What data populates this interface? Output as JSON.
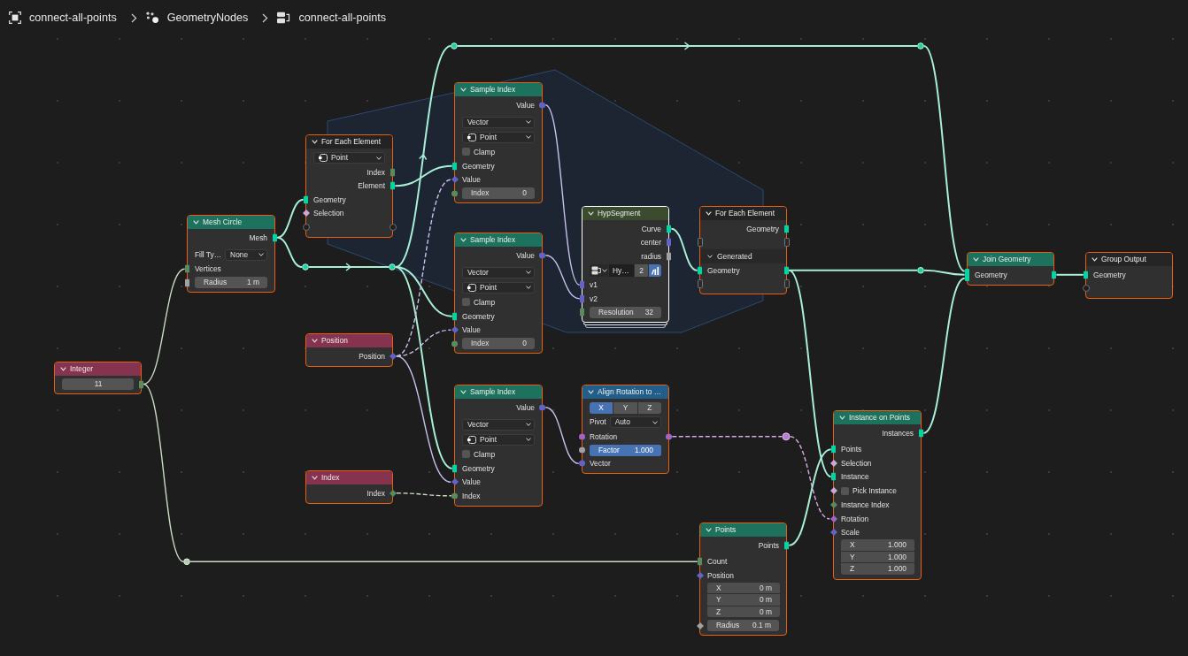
{
  "breadcrumbs": [
    {
      "kind": "object",
      "label": "connect-all-points"
    },
    {
      "kind": "modifier",
      "label": "GeometryNodes"
    },
    {
      "kind": "node_group",
      "label": "connect-all-points"
    }
  ],
  "nodes": [
    {
      "title": "Integer",
      "kind": "input",
      "selected": true,
      "active": false,
      "rows": [
        {
          "kind": "field",
          "value": "11",
          "output": {
            "kind": "bar",
            "color": "#598c5c"
          }
        }
      ]
    },
    {
      "title": "Mesh Circle",
      "kind": "geometry",
      "selected": true,
      "active": false,
      "rows": [
        {
          "kind": "socket",
          "label": "Mesh",
          "output": {
            "kind": "bar",
            "color": "#00d6a3"
          }
        },
        {
          "kind": "dropdown",
          "label": "Fill Ty…",
          "value": "None"
        },
        {
          "kind": "socket",
          "label": "Vertices",
          "input": {
            "kind": "bar",
            "color": "#598c5c"
          }
        },
        {
          "kind": "field",
          "label": "Radius",
          "value": "1 m",
          "input": {
            "kind": "bar",
            "color": "#a1a1a1"
          }
        }
      ]
    },
    {
      "title": "For Each Element",
      "kind": "zone",
      "selected": true,
      "active": false,
      "rows": [
        {
          "kind": "domain",
          "value": "Point"
        },
        {
          "kind": "socket",
          "label": "Index",
          "output": {
            "kind": "bar",
            "color": "#598c5c"
          }
        },
        {
          "kind": "socket",
          "label": "Element",
          "output": {
            "kind": "bar",
            "color": "#00d6a3"
          }
        },
        {
          "kind": "socket",
          "label": "Geometry",
          "input": {
            "kind": "bar",
            "color": "#00d6a3"
          }
        },
        {
          "kind": "socket",
          "label": "Selection",
          "input": {
            "kind": "diamond",
            "color": "#cca6d6"
          }
        },
        {
          "kind": "socket",
          "input": {
            "kind": "ring"
          },
          "output": {
            "kind": "ring"
          }
        }
      ]
    },
    {
      "title": "Position",
      "kind": "input",
      "selected": true,
      "active": false,
      "rows": [
        {
          "kind": "socket",
          "label": "Position",
          "output": {
            "kind": "diamond",
            "color": "#6363c7"
          }
        }
      ]
    },
    {
      "title": "Index",
      "kind": "input",
      "selected": true,
      "active": false,
      "rows": [
        {
          "kind": "socket",
          "label": "Index",
          "output": {
            "kind": "diamond",
            "color": "#598c5c"
          }
        }
      ]
    },
    {
      "title": "Sample Index",
      "kind": "geometry",
      "selected": true,
      "active": false,
      "rows": [
        {
          "kind": "socket",
          "label": "Value",
          "output": {
            "kind": "circle",
            "color": "#6363c7"
          }
        },
        {
          "kind": "dropdown",
          "value": "Vector"
        },
        {
          "kind": "domain",
          "value": "Point"
        },
        {
          "kind": "checkbox",
          "label": "Clamp",
          "checked": false
        },
        {
          "kind": "socket",
          "label": "Geometry",
          "input": {
            "kind": "bar",
            "color": "#00d6a3"
          }
        },
        {
          "kind": "socket",
          "label": "Value",
          "input": {
            "kind": "diamond",
            "color": "#6363c7"
          }
        },
        {
          "kind": "field",
          "label": "Index",
          "value": "0",
          "input": {
            "kind": "circle",
            "color": "#598c5c"
          }
        }
      ]
    },
    {
      "title": "Sample Index",
      "kind": "geometry",
      "selected": true,
      "active": false,
      "rows": [
        {
          "kind": "socket",
          "label": "Value",
          "output": {
            "kind": "circle",
            "color": "#6363c7"
          }
        },
        {
          "kind": "dropdown",
          "value": "Vector"
        },
        {
          "kind": "domain",
          "value": "Point"
        },
        {
          "kind": "checkbox",
          "label": "Clamp",
          "checked": false
        },
        {
          "kind": "socket",
          "label": "Geometry",
          "input": {
            "kind": "bar",
            "color": "#00d6a3"
          }
        },
        {
          "kind": "socket",
          "label": "Value",
          "input": {
            "kind": "diamond",
            "color": "#6363c7"
          }
        },
        {
          "kind": "field",
          "label": "Index",
          "value": "0",
          "input": {
            "kind": "circle",
            "color": "#598c5c"
          }
        }
      ]
    },
    {
      "title": "Sample Index",
      "kind": "geometry",
      "selected": true,
      "active": false,
      "rows": [
        {
          "kind": "socket",
          "label": "Value",
          "output": {
            "kind": "circle",
            "color": "#6363c7"
          }
        },
        {
          "kind": "dropdown",
          "value": "Vector"
        },
        {
          "kind": "domain",
          "value": "Point"
        },
        {
          "kind": "checkbox",
          "label": "Clamp",
          "checked": false
        },
        {
          "kind": "socket",
          "label": "Geometry",
          "input": {
            "kind": "bar",
            "color": "#00d6a3"
          }
        },
        {
          "kind": "socket",
          "label": "Value",
          "input": {
            "kind": "diamond",
            "color": "#6363c7"
          }
        },
        {
          "kind": "socket",
          "label": "Index",
          "input": {
            "kind": "circle",
            "color": "#598c5c"
          }
        }
      ]
    },
    {
      "title": "HypSegment",
      "kind": "group",
      "selected": true,
      "active": true,
      "rows": [
        {
          "kind": "socket",
          "label": "Curve",
          "output": {
            "kind": "bar",
            "color": "#00d6a3"
          }
        },
        {
          "kind": "socket",
          "label": "center",
          "output": {
            "kind": "bar",
            "color": "#6363c7"
          }
        },
        {
          "kind": "socket",
          "label": "radius",
          "output": {
            "kind": "bar",
            "color": "#a1a1a1"
          }
        },
        {
          "kind": "datablock",
          "name": "Hy…",
          "users": "2",
          "on": true
        },
        {
          "kind": "socket",
          "label": "v1",
          "input": {
            "kind": "bar",
            "color": "#6363c7"
          }
        },
        {
          "kind": "socket",
          "label": "v2",
          "input": {
            "kind": "bar",
            "color": "#6363c7"
          }
        },
        {
          "kind": "field",
          "label": "Resolution",
          "value": "32",
          "input": {
            "kind": "bar",
            "color": "#598c5c"
          }
        }
      ]
    },
    {
      "title": "Align Rotation to …",
      "kind": "converter",
      "selected": true,
      "active": false,
      "rows": [
        {
          "kind": "toggle",
          "options": [
            {
              "label": "X",
              "selected": true
            },
            {
              "label": "Y",
              "selected": false
            },
            {
              "label": "Z",
              "selected": false
            }
          ]
        },
        {
          "kind": "dropdown",
          "label": "Pivot",
          "value": "Auto"
        },
        {
          "kind": "socket",
          "label": "Rotation",
          "input": {
            "kind": "circle",
            "color": "#a663c7"
          },
          "output": {
            "kind": "circle",
            "color": "#a663c7"
          }
        },
        {
          "kind": "slider",
          "label": "Factor",
          "value": "1.000",
          "level": 1,
          "input": {
            "kind": "circle",
            "color": "#a1a1a1"
          }
        },
        {
          "kind": "socket",
          "label": "Vector",
          "input": {
            "kind": "circle",
            "color": "#6363c7"
          }
        }
      ]
    },
    {
      "title": "For Each Element",
      "kind": "zone",
      "selected": true,
      "active": false,
      "rows": [
        {
          "kind": "socket",
          "label": "Geometry",
          "output": {
            "kind": "bar",
            "color": "#00d6a3"
          }
        },
        {
          "kind": "socket",
          "input": {
            "kind": "slot"
          },
          "output": {
            "kind": "slot"
          }
        },
        {
          "kind": "panel",
          "label": "Generated",
          "expanded": true
        },
        {
          "kind": "socket",
          "label": "Geometry",
          "input": {
            "kind": "bar",
            "color": "#00d6a3"
          },
          "output": {
            "kind": "bar",
            "color": "#00d6a3"
          }
        },
        {
          "kind": "socket",
          "input": {
            "kind": "slot"
          },
          "output": {
            "kind": "slot"
          }
        }
      ]
    },
    {
      "title": "Points",
      "kind": "geometry",
      "selected": true,
      "active": false,
      "rows": [
        {
          "kind": "socket",
          "label": "Points",
          "output": {
            "kind": "bar",
            "color": "#00d6a3"
          }
        },
        {
          "kind": "socket",
          "label": "Count",
          "input": {
            "kind": "bar",
            "color": "#598c5c"
          }
        },
        {
          "kind": "vector",
          "label": "Position",
          "input": {
            "kind": "diamond",
            "color": "#6363c7"
          },
          "components": [
            {
              "label": "X",
              "value": "0 m"
            },
            {
              "label": "Y",
              "value": "0 m"
            },
            {
              "label": "Z",
              "value": "0 m"
            }
          ]
        },
        {
          "kind": "field",
          "label": "Radius",
          "value": "0.1 m",
          "input": {
            "kind": "diamond",
            "color": "#a1a1a1"
          }
        }
      ]
    },
    {
      "title": "Instance on Points",
      "kind": "geometry",
      "selected": true,
      "active": false,
      "rows": [
        {
          "kind": "socket",
          "label": "Instances",
          "output": {
            "kind": "bar",
            "color": "#00d6a3"
          }
        },
        {
          "kind": "socket",
          "label": "Points",
          "input": {
            "kind": "bar",
            "color": "#00d6a3"
          }
        },
        {
          "kind": "socket",
          "label": "Selection",
          "input": {
            "kind": "diamond",
            "color": "#cca6d6"
          }
        },
        {
          "kind": "socket",
          "label": "Instance",
          "input": {
            "kind": "bar",
            "color": "#00d6a3"
          }
        },
        {
          "kind": "checkbox",
          "label": "Pick Instance",
          "checked": false,
          "input": {
            "kind": "diamond",
            "color": "#cca6d6"
          }
        },
        {
          "kind": "socket",
          "label": "Instance Index",
          "input": {
            "kind": "diamond",
            "color": "#598c5c"
          }
        },
        {
          "kind": "socket",
          "label": "Rotation",
          "input": {
            "kind": "diamond",
            "color": "#a663c7"
          }
        },
        {
          "kind": "vector",
          "label": "Scale",
          "input": {
            "kind": "diamond",
            "color": "#6363c7"
          },
          "components": [
            {
              "label": "X",
              "value": "1.000"
            },
            {
              "label": "Y",
              "value": "1.000"
            },
            {
              "label": "Z",
              "value": "1.000"
            }
          ]
        }
      ]
    },
    {
      "title": "Join Geometry",
      "kind": "geometry",
      "selected": true,
      "active": false,
      "rows": [
        {
          "kind": "socket",
          "label": "Geometry",
          "input": {
            "kind": "multi",
            "color": "#00d6a3"
          },
          "output": {
            "kind": "bar",
            "color": "#00d6a3"
          }
        }
      ]
    },
    {
      "title": "Group Output",
      "kind": "output",
      "selected": true,
      "active": false,
      "rows": [
        {
          "kind": "socket",
          "label": "Geometry",
          "input": {
            "kind": "bar",
            "color": "#00d6a3"
          }
        },
        {
          "kind": "socket",
          "input": {
            "kind": "ring"
          }
        }
      ]
    }
  ]
}
